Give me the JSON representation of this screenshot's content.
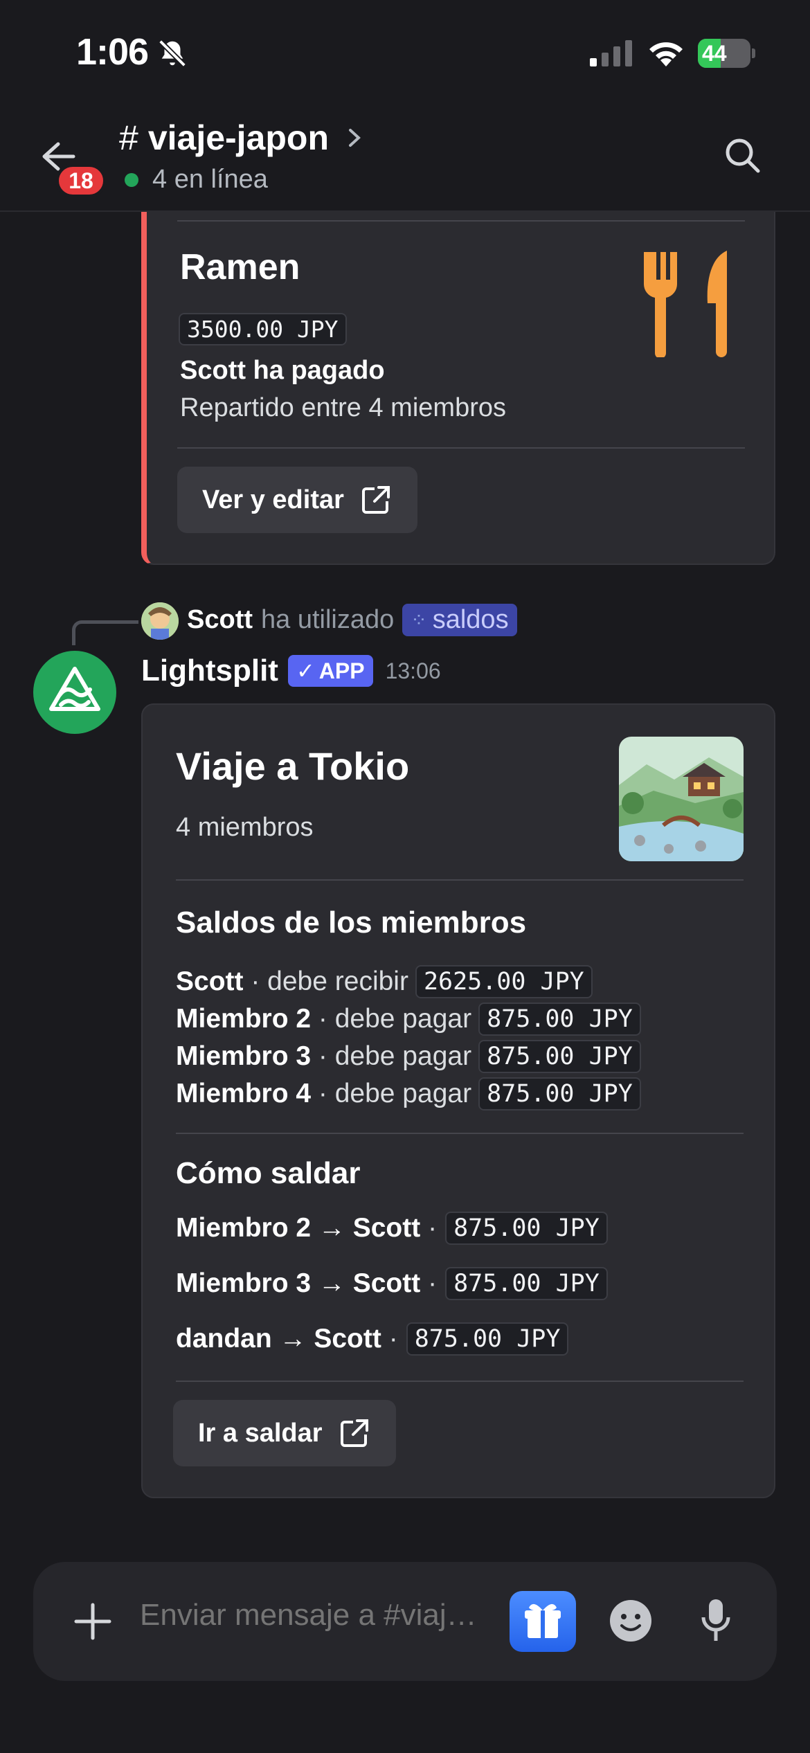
{
  "status_bar": {
    "time": "1:06",
    "battery": "44",
    "battery_level": 0.44
  },
  "header": {
    "unread_count": "18",
    "channel_hash": "#",
    "channel_name": "viaje-japon",
    "online": "4 en línea"
  },
  "expense_embed": {
    "title": "Ramen",
    "amount": "3500.00 JPY",
    "payer": "Scott ha pagado",
    "split": "Repartido entre 4 miembros",
    "button": "Ver y editar",
    "accent_color": "#f25f5c"
  },
  "reply": {
    "user": "Scott",
    "action": "ha utilizado",
    "command": "saldos"
  },
  "message": {
    "author": "Lightsplit",
    "tag": "APP",
    "time": "13:06"
  },
  "balance_embed": {
    "title": "Viaje a Tokio",
    "members": "4 miembros",
    "balances_title": "Saldos de los miembros",
    "balances": [
      {
        "name": "Scott",
        "status": "· debe recibir",
        "amount": "2625.00 JPY"
      },
      {
        "name": "Miembro 2",
        "status": "· debe pagar",
        "amount": "875.00 JPY"
      },
      {
        "name": "Miembro 3",
        "status": "· debe pagar",
        "amount": "875.00 JPY"
      },
      {
        "name": "Miembro 4",
        "status": "· debe pagar",
        "amount": "875.00 JPY"
      }
    ],
    "settle_title": "Cómo saldar",
    "settlements": [
      {
        "route": "Miembro 2 → Scott",
        "sep": "·",
        "amount": "875.00 JPY"
      },
      {
        "route": "Miembro 3 → Scott",
        "sep": "·",
        "amount": "875.00 JPY"
      },
      {
        "route": "dandan → Scott",
        "sep": "·",
        "amount": "875.00 JPY"
      }
    ],
    "button": "Ir a saldar"
  },
  "composer": {
    "placeholder": "Enviar mensaje a #viaje-japon"
  }
}
